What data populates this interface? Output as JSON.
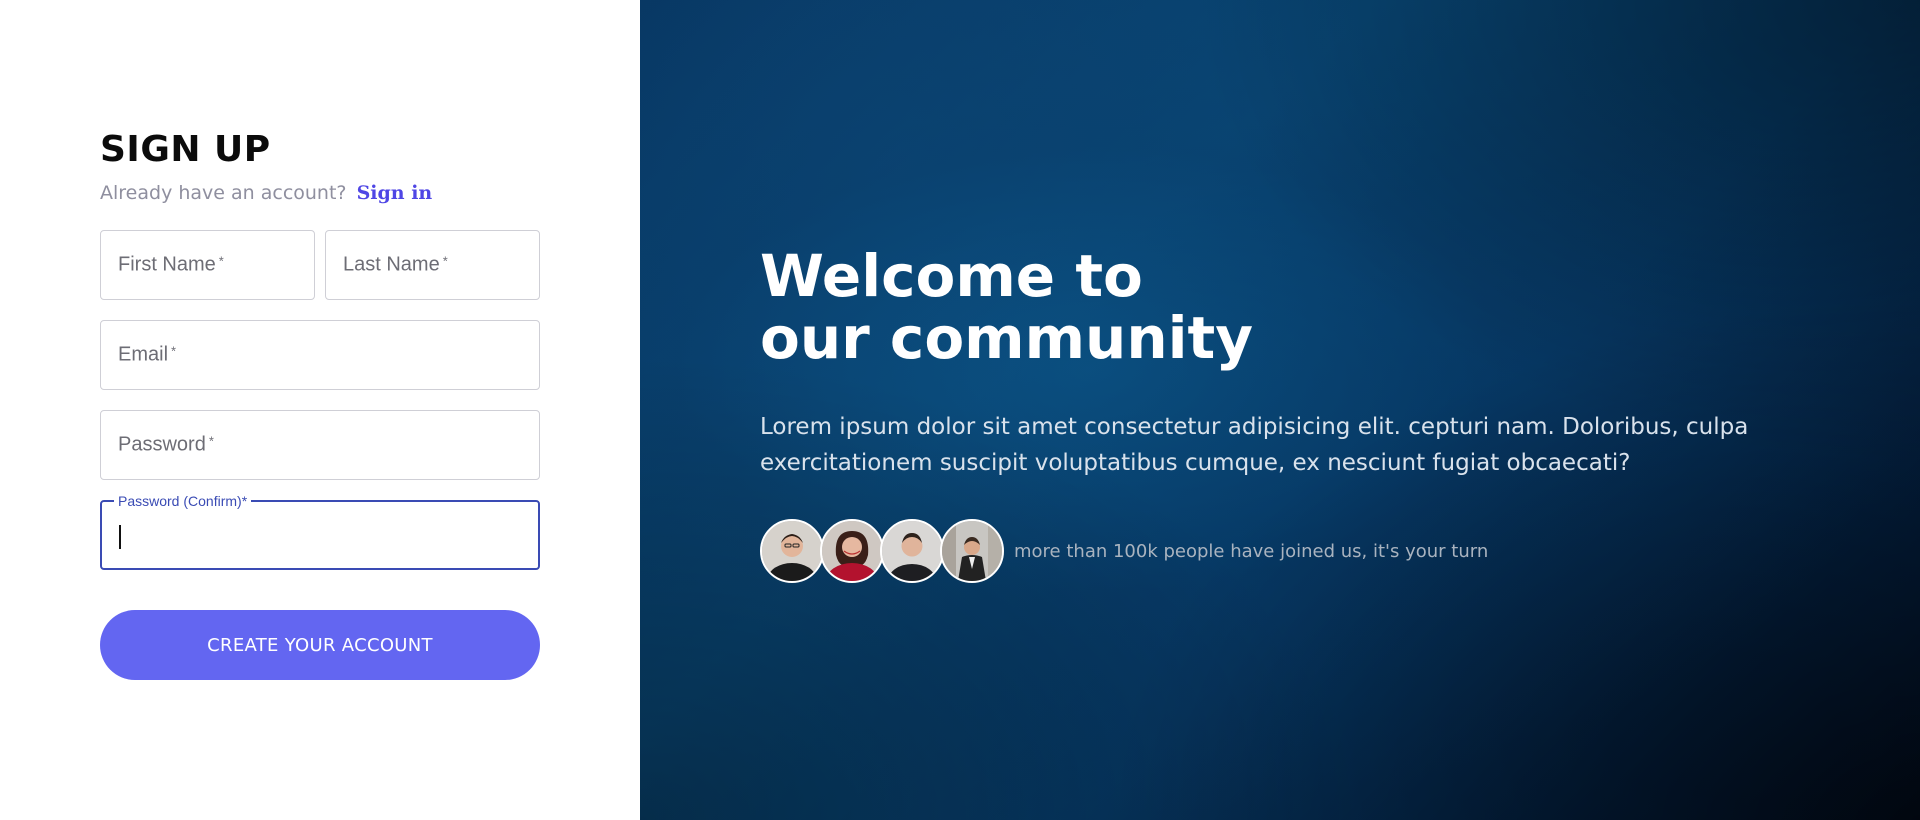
{
  "signup": {
    "title": "SIGN UP",
    "subtitle": "Already have an account?",
    "signin_link": "Sign in",
    "fields": {
      "first_name": {
        "placeholder": "First Name",
        "required": "*"
      },
      "last_name": {
        "placeholder": "Last Name",
        "required": "*"
      },
      "email": {
        "placeholder": "Email",
        "required": "*"
      },
      "password": {
        "placeholder": "Password",
        "required": "*"
      },
      "password_confirm": {
        "label": "Password (Confirm)",
        "required": "*",
        "value": ""
      }
    },
    "submit_label": "CREATE YOUR ACCOUNT"
  },
  "hero": {
    "title_line1": "Welcome to",
    "title_line2": "our community",
    "description": "Lorem ipsum dolor sit amet consectetur adipisicing elit. cepturi nam. Doloribus, culpa exercitationem suscipit voluptatibus cumque, ex nesciunt fugiat obcaecati?",
    "joined_text": "more than 100k people have joined us, it's your turn",
    "avatars": [
      "user-avatar",
      "user-avatar",
      "user-avatar",
      "user-avatar"
    ]
  },
  "colors": {
    "accent": "#6366f1",
    "link": "#4f46e5",
    "focus_border": "#3a4bb4",
    "hero_bg": "#084674"
  }
}
